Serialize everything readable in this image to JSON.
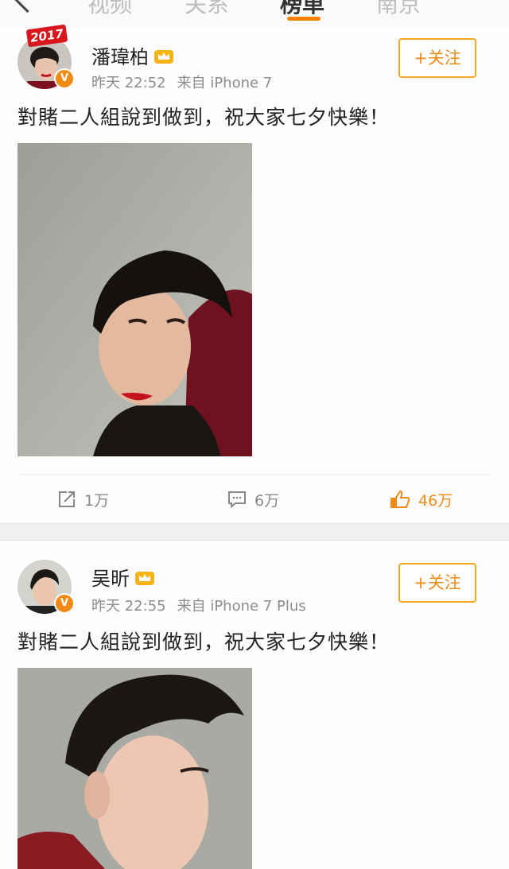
{
  "nav": {
    "tabs": [
      {
        "label": "视频"
      },
      {
        "label": "关系"
      },
      {
        "label": "榜单"
      },
      {
        "label": "南京"
      }
    ],
    "active_tab": 2,
    "accent": "#ff8200"
  },
  "posts": [
    {
      "author": "潘瑋柏",
      "badge_year": "2017",
      "time": "昨天 22:52",
      "source": "来自 iPhone 7",
      "follow_label": "+关注",
      "text": "對賭二人組說到做到，祝大家七夕快樂！",
      "actions": {
        "repost": "1万",
        "comment": "6万",
        "like": "46万"
      }
    },
    {
      "author": "吴昕",
      "time": "昨天 22:55",
      "source": "来自 iPhone 7 Plus",
      "follow_label": "+关注",
      "text": "對賭二人組說到做到，祝大家七夕快樂！"
    }
  ],
  "icons": [
    "back-arrow-icon",
    "verified-v-icon",
    "crown-icon",
    "repost-icon",
    "comment-icon",
    "like-icon"
  ],
  "colors": {
    "orange": "#f08a16",
    "follow_border": "#f5a623",
    "meta_gray": "#8c8c8c"
  }
}
